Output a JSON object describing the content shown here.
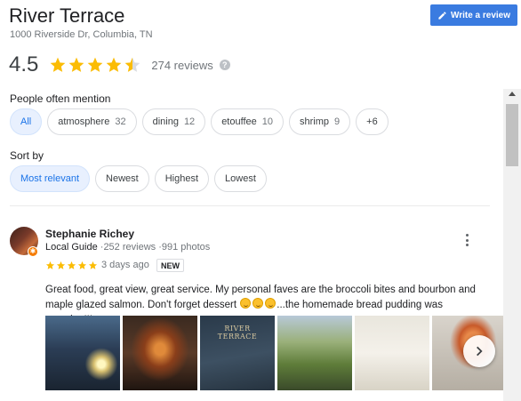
{
  "place": {
    "name": "River Terrace",
    "address": "1000 Riverside Dr, Columbia, TN"
  },
  "write_review_label": "Write a review",
  "rating": {
    "value": "4.5",
    "stars": 4.5,
    "reviews_text": "274 reviews",
    "help_glyph": "?"
  },
  "mentions": {
    "label": "People often mention",
    "chips": [
      {
        "label": "All",
        "count": ""
      },
      {
        "label": "atmosphere",
        "count": "32"
      },
      {
        "label": "dining",
        "count": "12"
      },
      {
        "label": "etouffee",
        "count": "10"
      },
      {
        "label": "shrimp",
        "count": "9"
      },
      {
        "label": "+6",
        "count": ""
      }
    ]
  },
  "sort": {
    "label": "Sort by",
    "options": [
      "Most relevant",
      "Newest",
      "Highest",
      "Lowest"
    ]
  },
  "review": {
    "name": "Stephanie Richey",
    "guide_label": "Local Guide",
    "reviews_meta": "·252 reviews",
    "photos_meta": "·991 photos",
    "stars": 5,
    "time": "3 days ago",
    "badge": "NEW",
    "text_part1": "Great food, great view, great service. My personal faves are the broccoli bites and bourbon and maple glazed salmon. Don't forget dessert ",
    "text_part2": "...the homemade bread pudding was amazing!!!",
    "photo_texts": [
      "",
      "",
      "RIVER TERRACE",
      "",
      "",
      ""
    ]
  },
  "colors": {
    "accent": "#3a7be0",
    "star": "#fbbc04",
    "chip_active_bg": "#e8f0fe",
    "chip_active_text": "#1a73e8"
  }
}
